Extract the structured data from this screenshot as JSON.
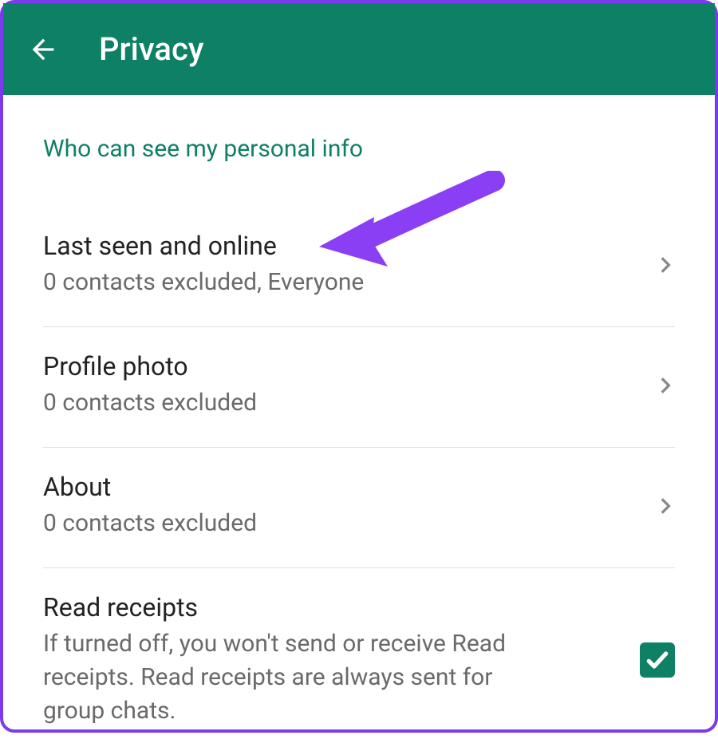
{
  "header": {
    "title": "Privacy"
  },
  "section": {
    "heading": "Who can see my personal info"
  },
  "rows": {
    "lastSeen": {
      "title": "Last seen and online",
      "subtitle": "0 contacts excluded, Everyone"
    },
    "profilePhoto": {
      "title": "Profile photo",
      "subtitle": "0 contacts excluded"
    },
    "about": {
      "title": "About",
      "subtitle": "0 contacts excluded"
    },
    "readReceipts": {
      "title": "Read receipts",
      "subtitle": "If turned off, you won't send or receive Read receipts. Read receipts are always sent for group chats.",
      "checked": true
    }
  },
  "colors": {
    "brand": "#0e8066",
    "annotation": "#8b3ff5"
  }
}
